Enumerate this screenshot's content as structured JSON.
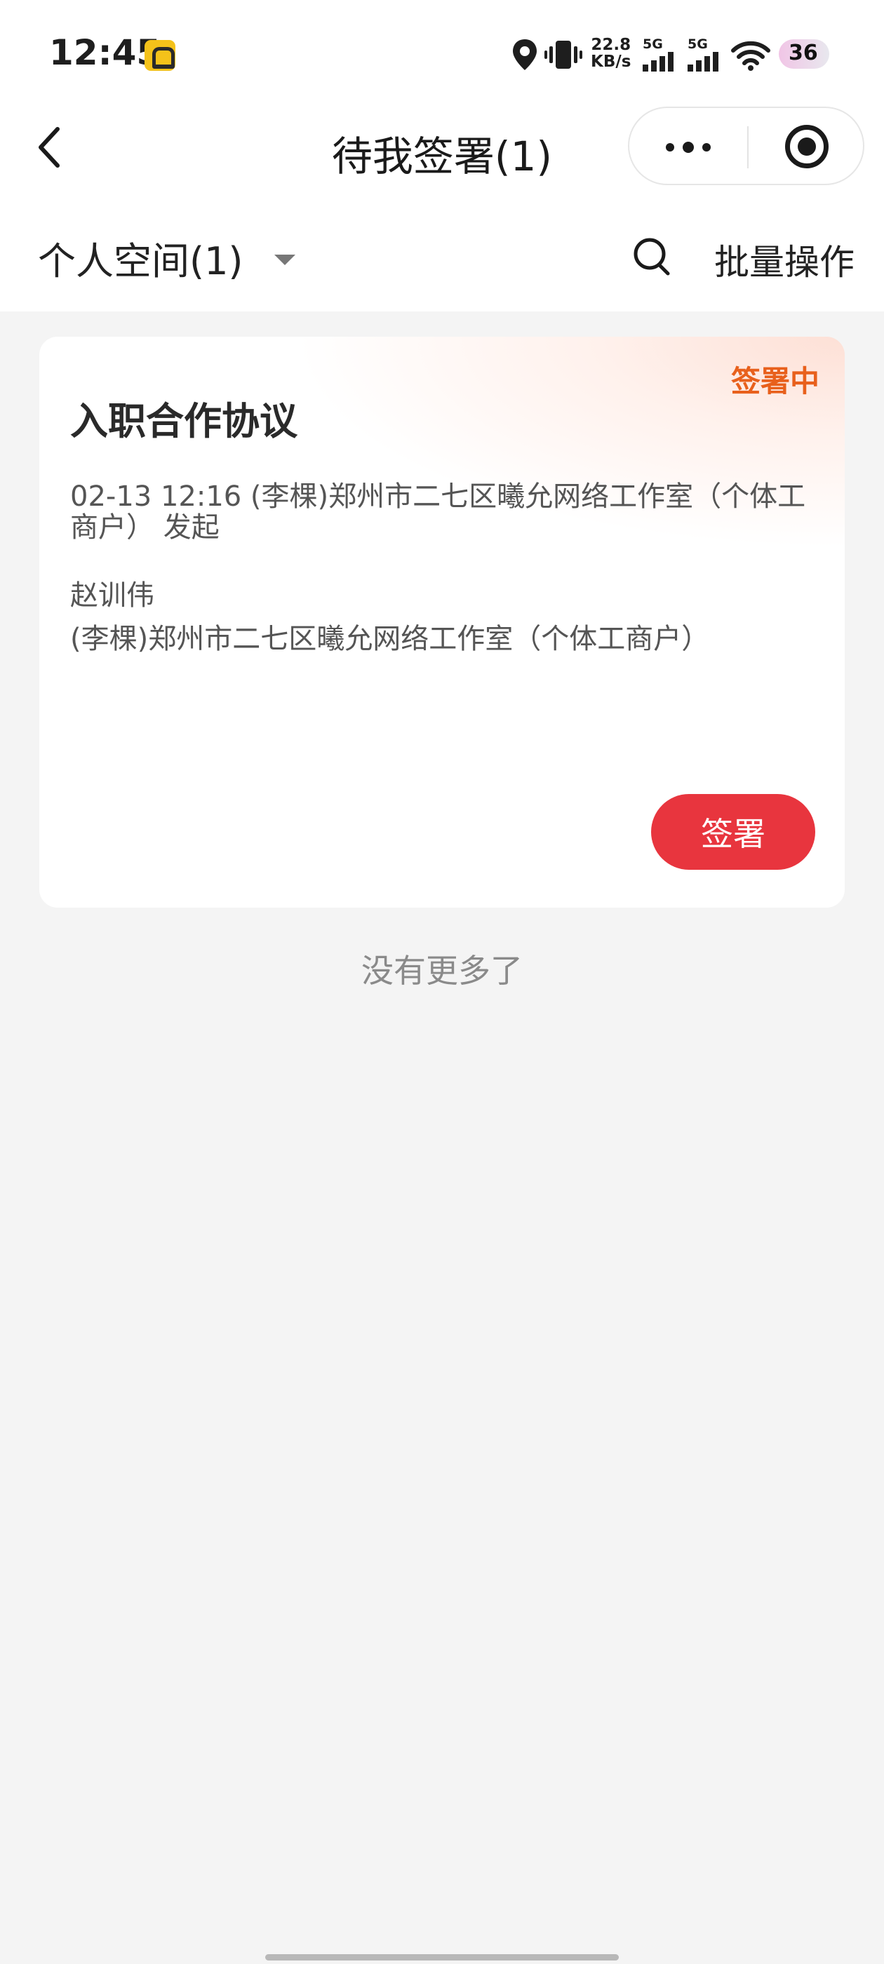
{
  "status_bar": {
    "time": "12:45",
    "net_speed_value": "22.8",
    "net_speed_unit": "KB/s",
    "sim1": "5G",
    "sim2": "5G",
    "battery": "36"
  },
  "nav": {
    "title": "待我签署(1)"
  },
  "filter": {
    "space_label": "个人空间(1)",
    "batch_label": "批量操作"
  },
  "card": {
    "status": "签署中",
    "title": "入职合作协议",
    "meta": "02-13 12:16 (李棵)郑州市二七区曦允网络工作室（个体工商户） 发起",
    "signer": "赵训伟",
    "org": "(李棵)郑州市二七区曦允网络工作室（个体工商户）",
    "sign_button": "签署"
  },
  "footer": {
    "no_more": "没有更多了"
  },
  "colors": {
    "accent_red": "#e8353e",
    "status_orange": "#e8601c"
  }
}
